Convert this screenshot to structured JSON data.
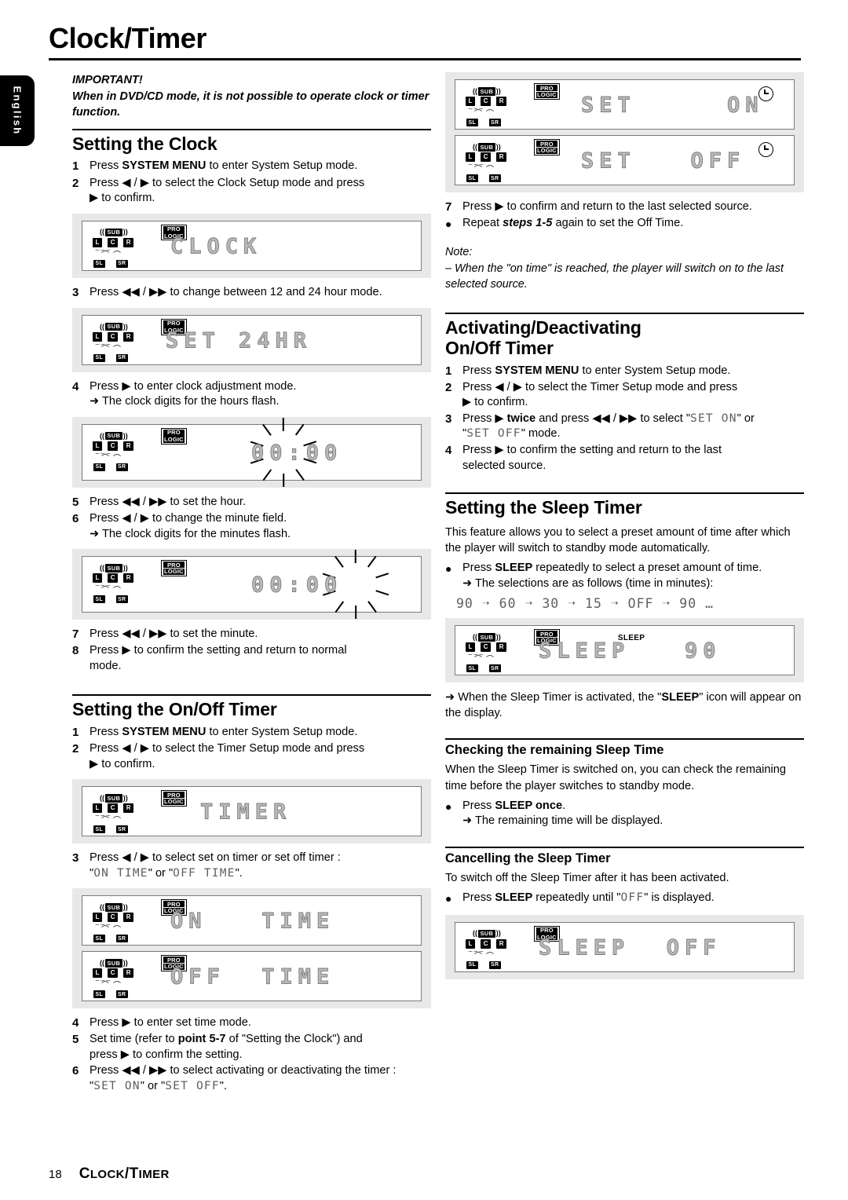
{
  "page": {
    "title": "Clock/Timer",
    "language_tab": "English",
    "footer_page_number": "18",
    "footer_title_parts": {
      "c": "C",
      "lock": "LOCK",
      "slash": "/",
      "t": "T",
      "imer": "IMER"
    }
  },
  "important": {
    "heading": "IMPORTANT!",
    "body": "When in DVD/CD mode, it is not possible to operate clock or timer function."
  },
  "sections": {
    "setting_the_clock": {
      "heading": "Setting the Clock",
      "steps": [
        {
          "num": "1",
          "text": "Press SYSTEM MENU to enter System Setup mode.",
          "bold": "SYSTEM MENU"
        },
        {
          "num": "2",
          "text": "Press ◀ / ▶ to select the Clock Setup mode and press ▶ to confirm."
        },
        {
          "num": "3",
          "text": "Press ◀◀ / ▶▶ to change between 12 and 24 hour mode."
        },
        {
          "num": "4",
          "text": "Press ▶ to enter clock adjustment mode.",
          "arrow": "➜ The clock digits for the hours flash."
        },
        {
          "num": "5",
          "text": "Press ◀◀ / ▶▶ to set the hour."
        },
        {
          "num": "6",
          "text": "Press ◀ / ▶ to change the minute field.",
          "arrow": "➜ The clock digits for the minutes flash."
        },
        {
          "num": "7",
          "text": "Press ◀◀ / ▶▶ to set the minute."
        },
        {
          "num": "8",
          "text": "Press ▶ to confirm the setting and return to normal mode."
        }
      ],
      "displays": {
        "clock": "CLOCK",
        "set24hr": "SET 24HR",
        "hours_flash": "00:00",
        "minutes_flash": "00:00"
      }
    },
    "setting_the_on_off_timer": {
      "heading": "Setting the On/Off Timer",
      "steps": [
        {
          "num": "1",
          "text": "Press SYSTEM MENU to enter System Setup mode.",
          "bold": "SYSTEM MENU"
        },
        {
          "num": "2",
          "text": "Press ◀ / ▶ to select the Timer Setup mode and press ▶ to confirm."
        },
        {
          "num": "3",
          "text": "Press ◀ / ▶ to select set on timer or set off timer :",
          "lcd_suffix": "\"ON TIME\" or \"OFF TIME\"."
        },
        {
          "num": "4",
          "text": "Press ▶ to enter set time mode."
        },
        {
          "num": "5",
          "text": "Set time (refer to point 5-7 of \"Setting the Clock\") and press ▶ to confirm the setting.",
          "bold": "point 5-7"
        },
        {
          "num": "6",
          "text": "Press ◀◀ / ▶▶ to select activating or deactivating the timer :",
          "lcd_suffix": "\"SET ON\" or \"SET OFF\"."
        },
        {
          "num": "7",
          "text": "Press ▶ to confirm and return to the last selected source."
        },
        {
          "num": "●",
          "text": "Repeat steps 1-5 again to set the Off Time.",
          "bolditalic": "steps 1-5"
        }
      ],
      "displays": {
        "timer": "TIMER",
        "on_time": "ON   TIME",
        "off_time": "OFF  TIME",
        "set_on": "SET     ON",
        "set_off": "SET   OFF"
      },
      "note": {
        "label": "Note:",
        "text": "–  When the \"on time\" is reached, the player will switch on to the last selected source."
      }
    },
    "activating_deactivating": {
      "heading_line1": "Activating/Deactivating",
      "heading_line2": "On/Off Timer",
      "steps": [
        {
          "num": "1",
          "text": "Press SYSTEM MENU to enter System Setup mode.",
          "bold": "SYSTEM MENU"
        },
        {
          "num": "2",
          "text": "Press ◀ / ▶ to select the Timer Setup mode and press ▶ to confirm."
        },
        {
          "num": "3",
          "text": "Press ▶ twice and press ◀◀ / ▶▶ to select \"SET ON\" or \"SET OFF\" mode.",
          "bold": "twice"
        },
        {
          "num": "4",
          "text": "Press ▶ to confirm the setting and return to the last selected source."
        }
      ]
    },
    "setting_the_sleep_timer": {
      "heading": "Setting the Sleep Timer",
      "intro": "This feature allows you to select a preset amount of time after which the player will switch to standby mode automatically.",
      "bullet": {
        "num": "●",
        "text": "Press SLEEP repeatedly to select a preset amount of time.",
        "bold": "SLEEP",
        "arrow": "➜ The selections are as follows (time in minutes):"
      },
      "sequence": "90 ➝ 60 ➝ 30 ➝  15 ➝ OFF ➝ 90 …",
      "display": {
        "text": "SLEEP   90",
        "indicator": "SLEEP"
      },
      "after_arrow": "➜ When the Sleep Timer is activated, the \"SLEEP\" icon will appear on the display.",
      "after_arrow_bold": "SLEEP"
    },
    "checking_remaining": {
      "heading": "Checking the remaining Sleep Time",
      "body": "When the Sleep Timer is switched on, you can check the remaining time before the player switches to standby mode.",
      "bullet": {
        "num": "●",
        "text": "Press SLEEP once.",
        "bold": "SLEEP once",
        "arrow": "➜ The remaining time will be displayed."
      }
    },
    "cancelling_sleep": {
      "heading": "Cancelling the Sleep Timer",
      "body": "To switch off the Sleep Timer after it has been activated.",
      "bullet": {
        "num": "●",
        "text": "Press SLEEP repeatedly until \"OFF\" is displayed.",
        "bold": "SLEEP",
        "lcd": "OFF"
      },
      "display": "SLEEP  OFF"
    }
  },
  "lcd_chrome": {
    "sub_label": "SUB",
    "left_paren": "((",
    "right_paren": "))",
    "channels": [
      "L",
      "C",
      "R"
    ],
    "surrounds": [
      "SL",
      "SR"
    ],
    "prologic_line1": "PRO",
    "prologic_line2": "LOGIC"
  },
  "colors": {
    "lcd_segment": "#b9b9b9",
    "lcd_segment_stroke": "#7d7d7d",
    "panel_bg": "#e8e8e8",
    "ink": "#000000"
  }
}
